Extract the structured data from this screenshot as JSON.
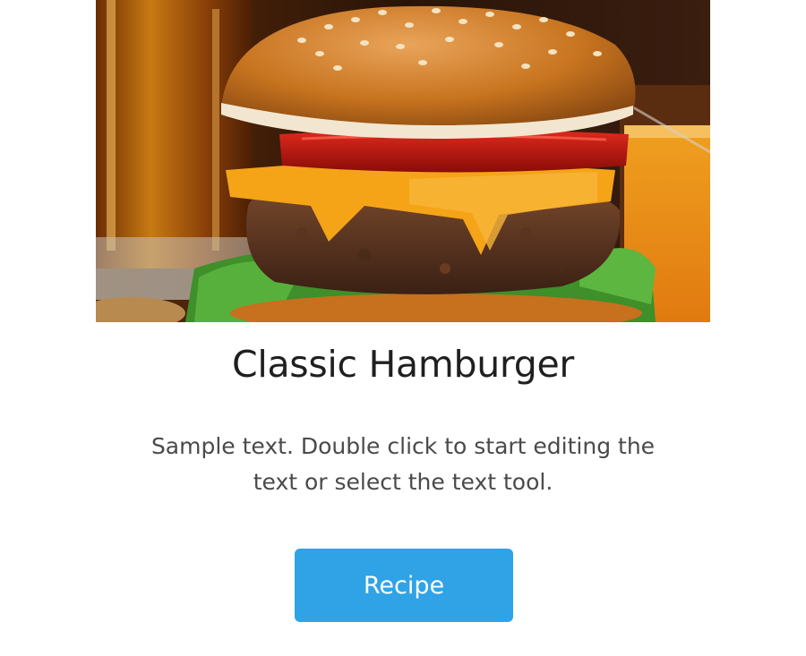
{
  "card": {
    "image_alt": "hamburger-photo",
    "title": "Classic Hamburger",
    "description": "Sample text. Double click to start editing the text or select the text tool.",
    "button_label": "Recipe"
  },
  "colors": {
    "button": "#2fa3e6",
    "title": "#1f1f1f",
    "text": "#4a4a4a"
  }
}
